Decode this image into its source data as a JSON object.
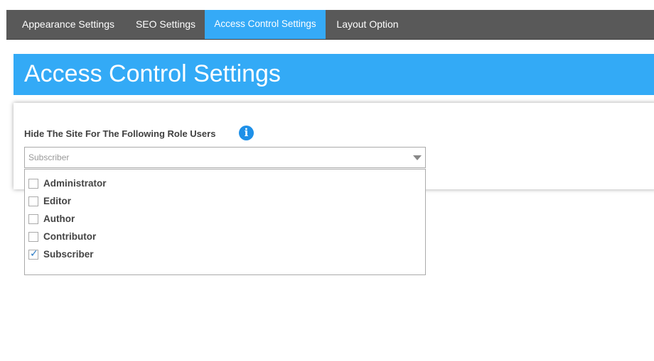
{
  "tabs": [
    {
      "label": "Appearance Settings",
      "active": false
    },
    {
      "label": "SEO Settings",
      "active": false
    },
    {
      "label": "Access Control Settings",
      "active": true
    },
    {
      "label": "Layout Option",
      "active": false
    }
  ],
  "page_title": "Access Control Settings",
  "hide_site": {
    "label": "Hide The Site For The Following Role Users",
    "info_icon": "info-icon",
    "selected_value": "Subscriber",
    "options": [
      {
        "label": "Administrator",
        "checked": false
      },
      {
        "label": "Editor",
        "checked": false
      },
      {
        "label": "Author",
        "checked": false
      },
      {
        "label": "Contributor",
        "checked": false
      },
      {
        "label": "Subscriber",
        "checked": true
      }
    ]
  },
  "colors": {
    "tabbar": "#595959",
    "accent": "#35aaf7",
    "info": "#1e90e8"
  }
}
